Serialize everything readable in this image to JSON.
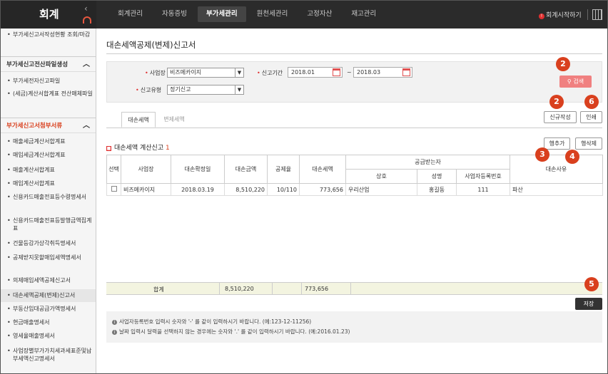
{
  "app": {
    "brand": "회계",
    "collapse_icon": "chevron-left-icon"
  },
  "nav": {
    "items": [
      "회계관리",
      "자동증빙",
      "부가세관리",
      "원천세관리",
      "고정자산",
      "재고관리"
    ],
    "active_index": 2,
    "start_link": "회계시작하기"
  },
  "sidebar": {
    "top_item": "부가세신고서작성현황 조회/마감",
    "group1": {
      "title": "부가세신고전산파일생성",
      "items": [
        "부가세전자신고파일",
        "(세금)계산서합계표 전산매체파일"
      ]
    },
    "group2": {
      "title": "부가세신고서첨부서류",
      "items": [
        "매출세금계산서합계표",
        "매입세금계산서합계표",
        "매출계산서합계표",
        "매입계산서합계표",
        "신용카드매출전표등수령명세서",
        "신용카드매출전표등발행금액집계표",
        "건물등감가상각취득명세서",
        "공제받지못할매입세액명세서",
        "의제매입세액공제신고서",
        "대손세액공제(변제)신고서",
        "부동산임대공급가액명세서",
        "현금매출명세서",
        "영세율매출명세서",
        "사업장별부가가치세과세표준및납부세액신고명세서"
      ],
      "active_index": 9
    }
  },
  "page": {
    "title": "대손세액공제(변제)신고서"
  },
  "search": {
    "business_label": "사업장",
    "business_value": "비즈메카이지",
    "period_label": "신고기간",
    "period_from": "2018.01",
    "period_to": "2018.03",
    "tilde": "~",
    "type_label": "신고유형",
    "type_value": "정기신고",
    "search_button": "검색"
  },
  "tabs": [
    "대손세액",
    "변제세액"
  ],
  "buttons": {
    "new": "신규작성",
    "print": "인쇄",
    "add_row": "행추가",
    "delete_row": "행삭제",
    "save": "저장"
  },
  "section": {
    "title": "대손세액 계산신고",
    "count": "1"
  },
  "table": {
    "headers": [
      "선택",
      "사업장",
      "대손확정일",
      "대손금액",
      "공제율",
      "대손세액",
      "공급받는자",
      "대손사유"
    ],
    "sub_headers": [
      "상호",
      "성명",
      "사업자등록번호"
    ],
    "rows": [
      {
        "business": "비즈메카이지",
        "date": "2018.03.19",
        "amount": "8,510,220",
        "rate": "10/110",
        "tax": "773,656",
        "company": "우리산업",
        "name": "홍길동",
        "reg_no": "111",
        "reason": "파산"
      }
    ],
    "total_label": "합계",
    "total_amount": "8,510,220",
    "total_tax": "773,656"
  },
  "notes": [
    "사업자등록번호 입력시 숫자와 '-' 를 같이 입력하시기 바랍니다. (예:123-12-11256)",
    "날짜 입력시 달력을 선택하지 않는 경우에는 숫자와 '.' 를 같이 입력하시기 바랍니다. (예:2016.01.23)"
  ],
  "callouts": [
    "2",
    "2",
    "6",
    "3",
    "4",
    "5"
  ],
  "colors": {
    "accent": "#d9401e",
    "topbar": "#2b2b2b",
    "search_btn": "#f08080"
  }
}
